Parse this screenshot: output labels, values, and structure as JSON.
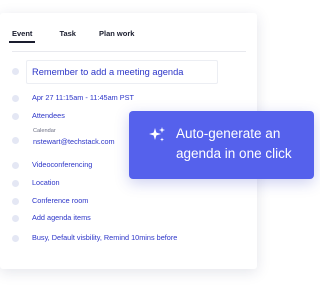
{
  "tabs": [
    {
      "label": "Event",
      "active": true
    },
    {
      "label": "Task",
      "active": false
    },
    {
      "label": "Plan work",
      "active": false
    }
  ],
  "title_field": {
    "value": "Remember to add a meeting agenda"
  },
  "fields": {
    "datetime": "Apr 27 11:15am - 11:45am PST",
    "attendees": "Attendees",
    "calendar_label": "Calendar",
    "calendar_value": "nstewart@techstack.com",
    "videoconferencing": "Videoconferencing",
    "location": "Location",
    "conference_room": "Conference room",
    "agenda": "Add agenda items",
    "settings": "Busy, Default visbility, Remind 10mins before"
  },
  "callout": {
    "text": "Auto-generate an agenda in one click",
    "icon": "sparkle-icon"
  },
  "colors": {
    "accent_text": "#2c35c8",
    "callout_bg": "#5561ec",
    "bullet": "#e4e7f4"
  }
}
